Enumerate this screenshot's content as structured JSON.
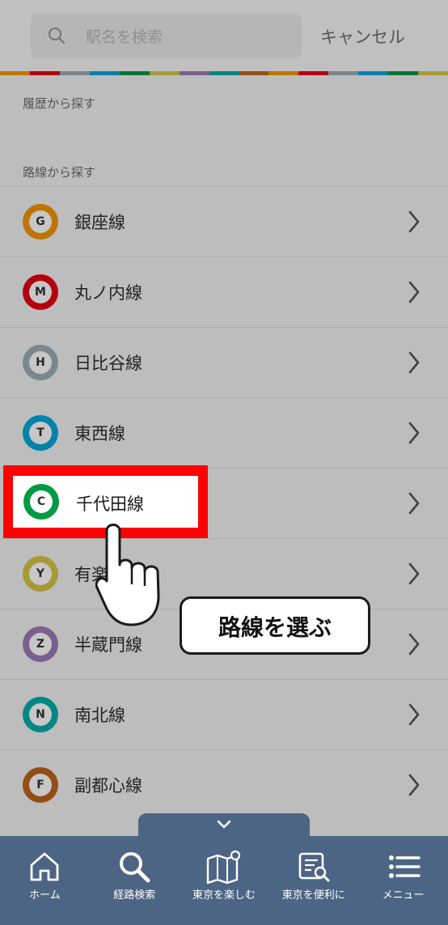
{
  "search": {
    "placeholder": "駅名を検索",
    "cancel_label": "キャンセル"
  },
  "sections": {
    "history_label": "履歴から探す",
    "lines_label": "路線から探す"
  },
  "lines": [
    {
      "code": "G",
      "name": "銀座線",
      "color": "#f39700"
    },
    {
      "code": "M",
      "name": "丸ノ内線",
      "color": "#e60012"
    },
    {
      "code": "H",
      "name": "日比谷線",
      "color": "#9caeb7"
    },
    {
      "code": "T",
      "name": "東西線",
      "color": "#00a7db"
    },
    {
      "code": "C",
      "name": "千代田線",
      "color": "#009944"
    },
    {
      "code": "Y",
      "name": "有楽町線",
      "color": "#d7c447"
    },
    {
      "code": "Z",
      "name": "半蔵門線",
      "color": "#9b7cb6"
    },
    {
      "code": "N",
      "name": "南北線",
      "color": "#00ada9"
    },
    {
      "code": "F",
      "name": "副都心線",
      "color": "#bb641d"
    }
  ],
  "highlight": {
    "code": "C",
    "name": "千代田線"
  },
  "callout": {
    "text": "路線を選ぶ"
  },
  "tabbar": {
    "items": [
      {
        "label": "ホーム",
        "icon": "home-icon"
      },
      {
        "label": "経路検索",
        "icon": "search-icon"
      },
      {
        "label": "東京を楽しむ",
        "icon": "map-icon"
      },
      {
        "label": "東京を便利に",
        "icon": "guide-icon"
      },
      {
        "label": "メニュー",
        "icon": "menu-icon"
      }
    ]
  },
  "colors": {
    "tabbar": "#4d6584",
    "highlight_border": "#ff0000"
  }
}
